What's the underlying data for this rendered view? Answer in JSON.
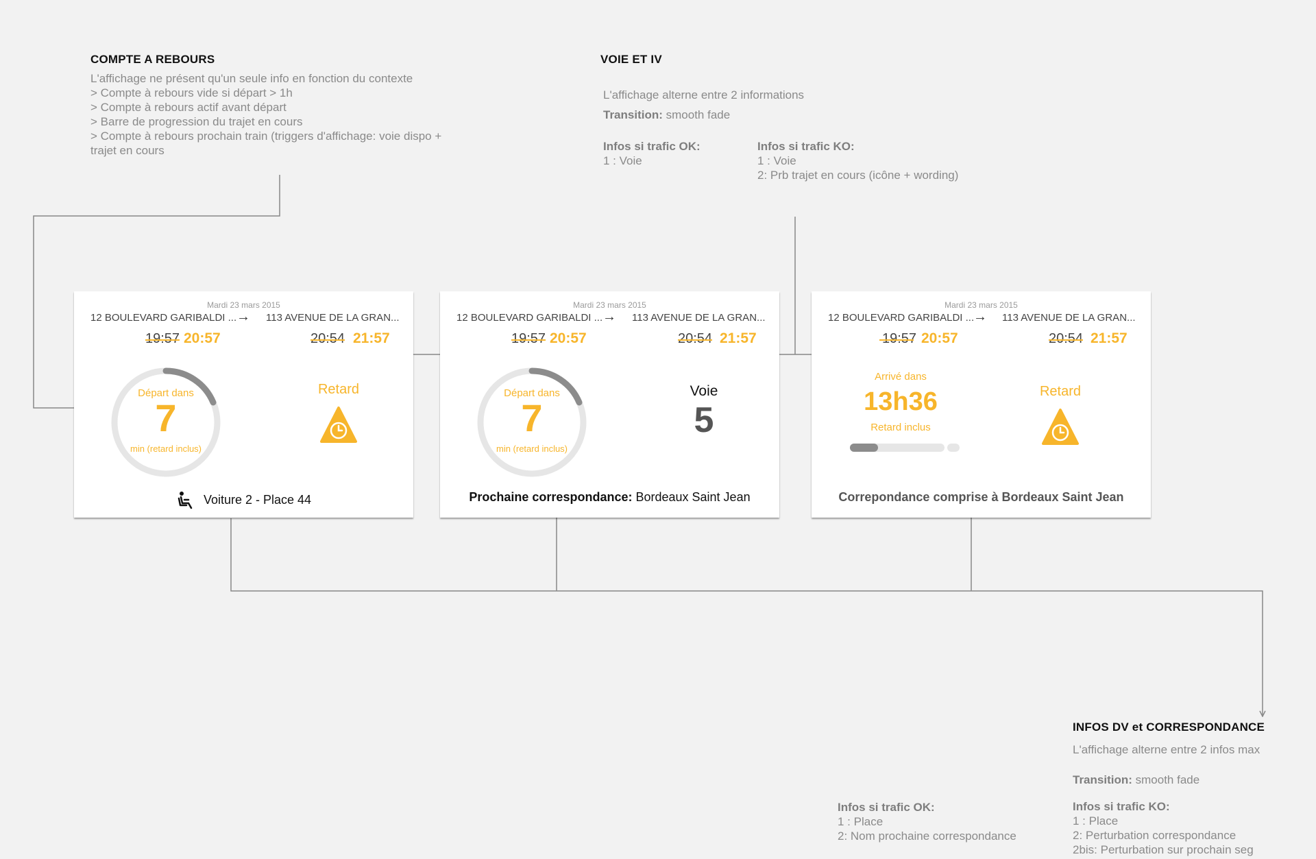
{
  "notes": {
    "countdown": {
      "title": "COMPTE A REBOURS",
      "lines": [
        "L'affichage  ne présent qu'un seule info en fonction du contexte",
        "> Compte à rebours vide si départ > 1h",
        "> Compte à rebours actif  avant départ",
        "> Barre de progression du trajet en cours",
        "> Compte à rebours prochain train (triggers d'affichage:  voie dispo +",
        "trajet en cours"
      ]
    },
    "voie": {
      "title": "VOIE ET IV",
      "line1": "L'affichage  alterne entre 2 informations",
      "transition_label": "Transition:",
      "transition_value": " smooth fade",
      "ok_title": "Infos si trafic OK:",
      "ok_items": [
        "1 : Voie"
      ],
      "ko_title": "Infos si trafic KO:",
      "ko_items": [
        "1 : Voie",
        "2:  Prb trajet en cours (icône + wording)"
      ]
    },
    "infos_dv": {
      "title": "INFOS DV et CORRESPONDANCE",
      "line1": "L'affichage  alterne entre 2 infos max",
      "transition_label": "Transition:",
      "transition_value": " smooth fade",
      "ok_title": "Infos si trafic OK:",
      "ok_items": [
        "1 : Place",
        "2:  Nom prochaine correspondance"
      ],
      "ko_title": "Infos si trafic KO:",
      "ko_items": [
        "1 : Place",
        "2:  Perturbation correspondance",
        "2bis:  Perturbation sur prochain seg"
      ]
    }
  },
  "cards": [
    {
      "date": "Mardi 23 mars 2015",
      "from": "12 BOULEVARD GARIBALDI ...",
      "to": "113 AVENUE DE LA GRAN...",
      "arrow": "→",
      "dep_old": "19:57",
      "dep_new": "20:57",
      "arr_old": "20:54",
      "arr_new": "21:57",
      "countdown_label": "Départ dans",
      "countdown_value": "7",
      "countdown_sub": "min (retard inclus)",
      "right_label": "Retard",
      "footer": "Voiture 2 - Place 44"
    },
    {
      "date": "Mardi 23 mars 2015",
      "from": "12 BOULEVARD GARIBALDI ...",
      "to": "113 AVENUE DE LA GRAN...",
      "arrow": "→",
      "dep_old": "19:57",
      "dep_new": "20:57",
      "arr_old": "20:54",
      "arr_new": "21:57",
      "countdown_label": "Départ dans",
      "countdown_value": "7",
      "countdown_sub": "min (retard inclus)",
      "voie_label": "Voie",
      "voie_value": "5",
      "footer_bold": "Prochaine correspondance:",
      "footer_rest": " Bordeaux Saint Jean"
    },
    {
      "date": "Mardi 23 mars 2015",
      "from": "12 BOULEVARD GARIBALDI ...",
      "to": "113 AVENUE DE LA GRAN...",
      "arrow": "→",
      "dep_old": "19:57",
      "dep_new": "20:57",
      "arr_old": "20:54",
      "arr_new": "21:57",
      "arrival_label": "Arrivé dans",
      "arrival_value": "13h36",
      "arrival_sub": "Retard inclus",
      "progress": 0.3,
      "right_label": "Retard",
      "footer": "Correpondance comprise à Bordeaux Saint Jean"
    }
  ],
  "colors": {
    "accent": "#f7b52b",
    "ring_track": "#e6e6e6",
    "ring_progress": "#8c8c8c",
    "connector": "#888888"
  }
}
